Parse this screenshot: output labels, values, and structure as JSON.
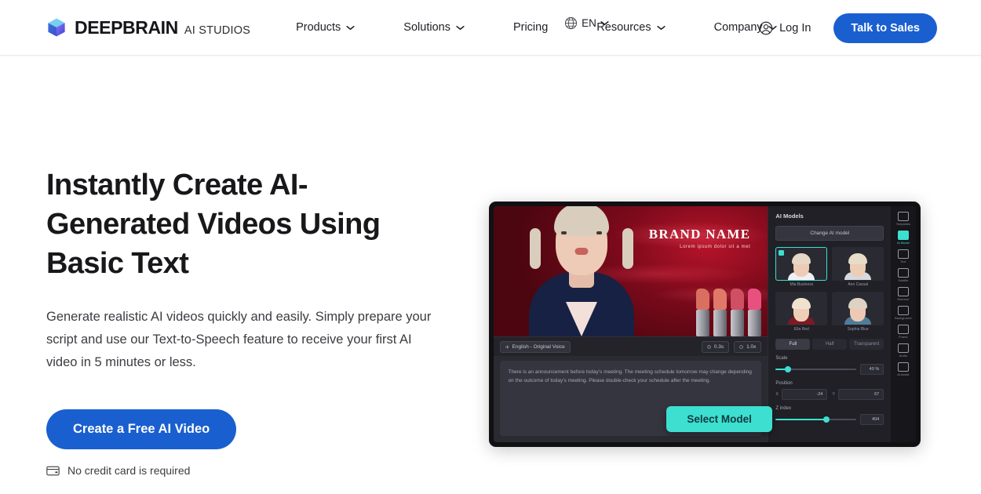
{
  "header": {
    "brand": {
      "name": "DEEPBRAIN",
      "suffix": "AI STUDIOS",
      "logo_icon": "cube-logo-icon"
    },
    "nav": [
      {
        "label": "Products",
        "has_dropdown": true
      },
      {
        "label": "Solutions",
        "has_dropdown": true
      },
      {
        "label": "Pricing",
        "has_dropdown": false
      },
      {
        "label": "Resources",
        "has_dropdown": true
      },
      {
        "label": "Company",
        "has_dropdown": true
      }
    ],
    "language": {
      "label": "EN",
      "icon": "globe-icon"
    },
    "login": {
      "label": "Log In",
      "icon": "user-circle-icon"
    },
    "cta": {
      "label": "Talk to Sales",
      "color": "#1a5fd0"
    }
  },
  "hero": {
    "headline": "Instantly Create AI-Generated Videos Using Basic Text",
    "subcopy": "Generate realistic AI videos quickly and easily. Simply prepare your script and use our Text-to-Speech feature to receive your first AI video in 5 minutes or less.",
    "primary_cta": "Create a Free AI Video",
    "note": {
      "text": "No credit card is required",
      "icon": "credit-card-icon"
    }
  },
  "app_mock": {
    "video": {
      "brand_title": "BRAND NAME",
      "brand_sub": "Lorem ipsum dolor sit a met",
      "voice_pill": "English - Original Voice",
      "voice_icon": "voice-wave-icon",
      "time_chips": [
        {
          "label": "0.3s",
          "icon": "clock-icon"
        },
        {
          "label": "1.0x",
          "icon": "speed-icon"
        }
      ],
      "script_text": "There is an announcement before today's meeting. The meeting schedule tomorrow may change depending on the outcome of today's meeting. Please double-check your schedule after the meeting."
    },
    "panel": {
      "title": "AI Models",
      "change_button": "Change AI model",
      "models": [
        {
          "caption": "Mia Business",
          "selected": true,
          "hair": "#e4d8c6",
          "skin": "#eecbb6",
          "outfit": "#f0f0f4"
        },
        {
          "caption": "Ann Casual",
          "selected": false,
          "hair": "#e7dcc8",
          "skin": "#eccdb6",
          "outfit": "#d8d9de"
        },
        {
          "caption": "Ella Red",
          "selected": false,
          "hair": "#efe3cf",
          "skin": "#f0cfb8",
          "outfit": "#7e1a24"
        },
        {
          "caption": "Sophia Blue",
          "selected": false,
          "hair": "#ded3c2",
          "skin": "#edc9b4",
          "outfit": "#4f7d99"
        }
      ],
      "tabs": [
        {
          "label": "Full",
          "active": true
        },
        {
          "label": "Half",
          "active": false
        },
        {
          "label": "Transparent",
          "active": false
        }
      ],
      "controls": [
        {
          "label": "Scale",
          "value": "40 %",
          "fill_pct": 14,
          "type": "slider",
          "icon": "scale-icon"
        },
        {
          "label": "Position",
          "type": "position",
          "x_key": "X",
          "x_value": "-24",
          "y_key": "Y",
          "y_value": "67"
        },
        {
          "label": "Z index",
          "value": "404",
          "fill_pct": 62,
          "type": "slider",
          "icon": "layers-icon"
        }
      ],
      "select_model_button": "Select Model",
      "select_model_color": "#3ddfd0"
    },
    "rail": [
      {
        "caption": "Templates",
        "icon": "templates-icon",
        "active": false
      },
      {
        "caption": "AI Model",
        "icon": "ai-model-icon",
        "active": true
      },
      {
        "caption": "Text",
        "icon": "text-icon",
        "active": false
      },
      {
        "caption": "Subtitle",
        "icon": "subtitle-icon",
        "active": false
      },
      {
        "caption": "Element",
        "icon": "element-icon",
        "active": false
      },
      {
        "caption": "Background",
        "icon": "background-icon",
        "active": false
      },
      {
        "caption": "Frame",
        "icon": "frame-icon",
        "active": false
      },
      {
        "caption": "Audio",
        "icon": "audio-icon",
        "active": false
      },
      {
        "caption": "AI Assist",
        "icon": "ai-assist-icon",
        "active": false
      }
    ],
    "cursor_icon": "mouse-pointer-icon"
  }
}
